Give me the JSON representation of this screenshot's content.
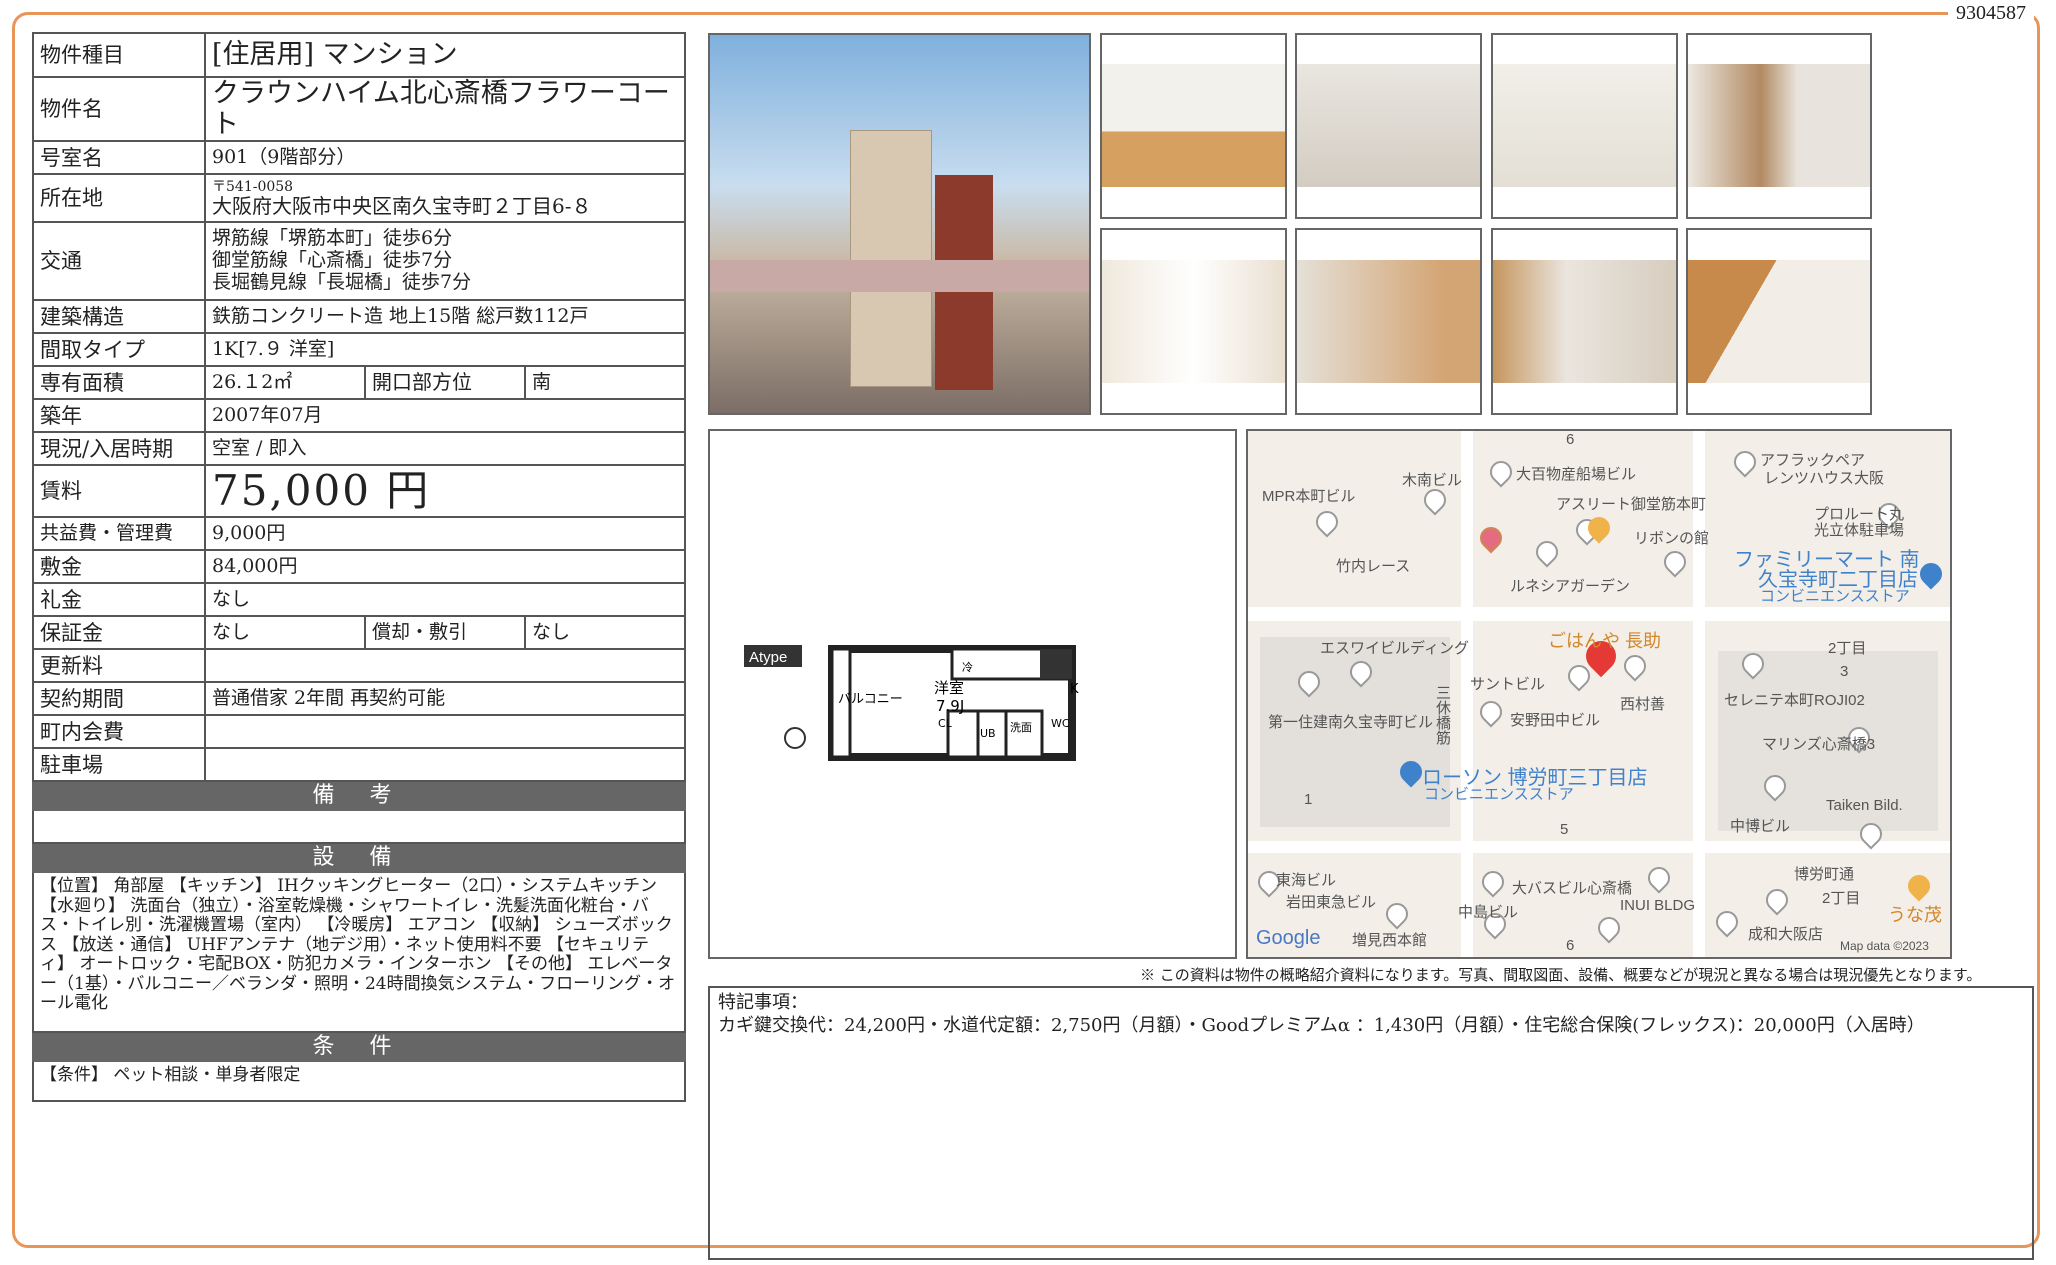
{
  "doc_number": "9304587",
  "property": {
    "type_label": "物件種目",
    "type": "[住居用] マンション",
    "name_label": "物件名",
    "name": "クラウンハイム北心斎橋フラワーコート",
    "room_label": "号室名",
    "room": "901（9階部分）",
    "address_label": "所在地",
    "postal": "〒541-0058",
    "address": "大阪府大阪市中央区南久宝寺町２丁目6-８",
    "transit_label": "交通",
    "transit": [
      "堺筋線「堺筋本町」徒歩6分",
      "御堂筋線「心斎橋」徒歩7分",
      "長堀鶴見線「長堀橋」徒歩7分"
    ],
    "structure_label": "建築構造",
    "structure": "鉄筋コンクリート造 地上15階 総戸数112戸",
    "layout_label": "間取タイプ",
    "layout": "1K[7.９ 洋室]",
    "area_label": "専有面積",
    "area": "26.１2㎡",
    "direction_label": "開口部方位",
    "direction": "南",
    "built_label": "築年",
    "built": "2007年07月",
    "status_label": "現況/入居時期",
    "status": "空室 / 即入",
    "rent_label": "賃料",
    "rent": "75,000 円",
    "fee_label": "共益費・管理費",
    "fee": "9,000円",
    "deposit_label": "敷金",
    "deposit": "84,000円",
    "key_money_label": "礼金",
    "key_money": "なし",
    "guarantee_label": "保証金",
    "guarantee": "なし",
    "amort_label": "償却・敷引",
    "amort": "なし",
    "renewal_label": "更新料",
    "renewal": "",
    "contract_label": "契約期間",
    "contract": "普通借家 2年間 再契約可能",
    "town_fee_label": "町内会費",
    "town_fee": "",
    "parking_label": "駐車場",
    "parking": ""
  },
  "sections": {
    "remarks": "備 考",
    "equipment": "設 備",
    "equipment_text": "【位置】 角部屋 【キッチン】 IHクッキングヒーター（2口）・システムキッチン 【水廻り】 洗面台（独立）・浴室乾燥機・シャワートイレ・洗髪洗面化粧台・バス・トイレ別・洗濯機置場（室内） 【冷暖房】 エアコン 【収納】 シューズボックス 【放送・通信】 UHFアンテナ（地デジ用）・ネット使用料不要 【セキュリティ】 オートロック・宅配BOX・防犯カメラ・インターホン 【その他】 エレベーター（1基）・バルコニー／ベランダ・照明・24時間換気システム・フローリング・オール電化",
    "conditions": "条 件",
    "conditions_text": "【条件】 ペット相談・単身者限定"
  },
  "floorplan": {
    "type_tag": "Atype",
    "room": "洋室",
    "room_size": "7.9J",
    "balcony": "バルコニー",
    "kitchen": "K",
    "fridge": "冷",
    "closet": "CL",
    "bath": "UB",
    "wash": "洗面",
    "toilet": "WC"
  },
  "map": {
    "labels": [
      "MPR本町ビル",
      "木南ビル",
      "大百物産船場ビル",
      "アスリート御堂筋本町",
      "リボンの館",
      "竹内レース",
      "ルネシアガーデン",
      "アフラックペア",
      "レンツハウス大阪",
      "プロルート丸",
      "光立体駐車場",
      "ファミリーマート 南",
      "久宝寺町二丁目店",
      "コンビニエンスストア",
      "ごはんや 長助",
      "エスワイビルディング",
      "サントビル",
      "西村善",
      "2丁目",
      "3",
      "セレニテ本町ROJI02",
      "第一住建南久宝寺町ビル",
      "安野田中ビル",
      "三休橋筋",
      "ローソン 博労町三丁目店",
      "コンビニエンスストア",
      "マリンズ心斎橋3",
      "1",
      "5",
      "中博ビル",
      "Taiken Bild.",
      "東海ビル",
      "博労町通",
      "大バスビル心斎橋",
      "岩田東急ビル",
      "2丁目",
      "INUI BLDG",
      "中島ビル",
      "うな茂",
      "成和大阪店",
      "増見西本館",
      "6",
      "6",
      "Google",
      "Map data ©2023"
    ]
  },
  "disclaimer": "※ この資料は物件の概略紹介資料になります。写真、間取図面、設備、概要などが現況と異なる場合は現況優先となります。",
  "notes_title": "特記事項：",
  "notes_text": "カギ鍵交換代：24,200円・水道代定額：2,750円（月額）・Goodプレミアムα ：1,430円（月額）・住宅総合保険(フレックス)：20,000円（入居時）"
}
